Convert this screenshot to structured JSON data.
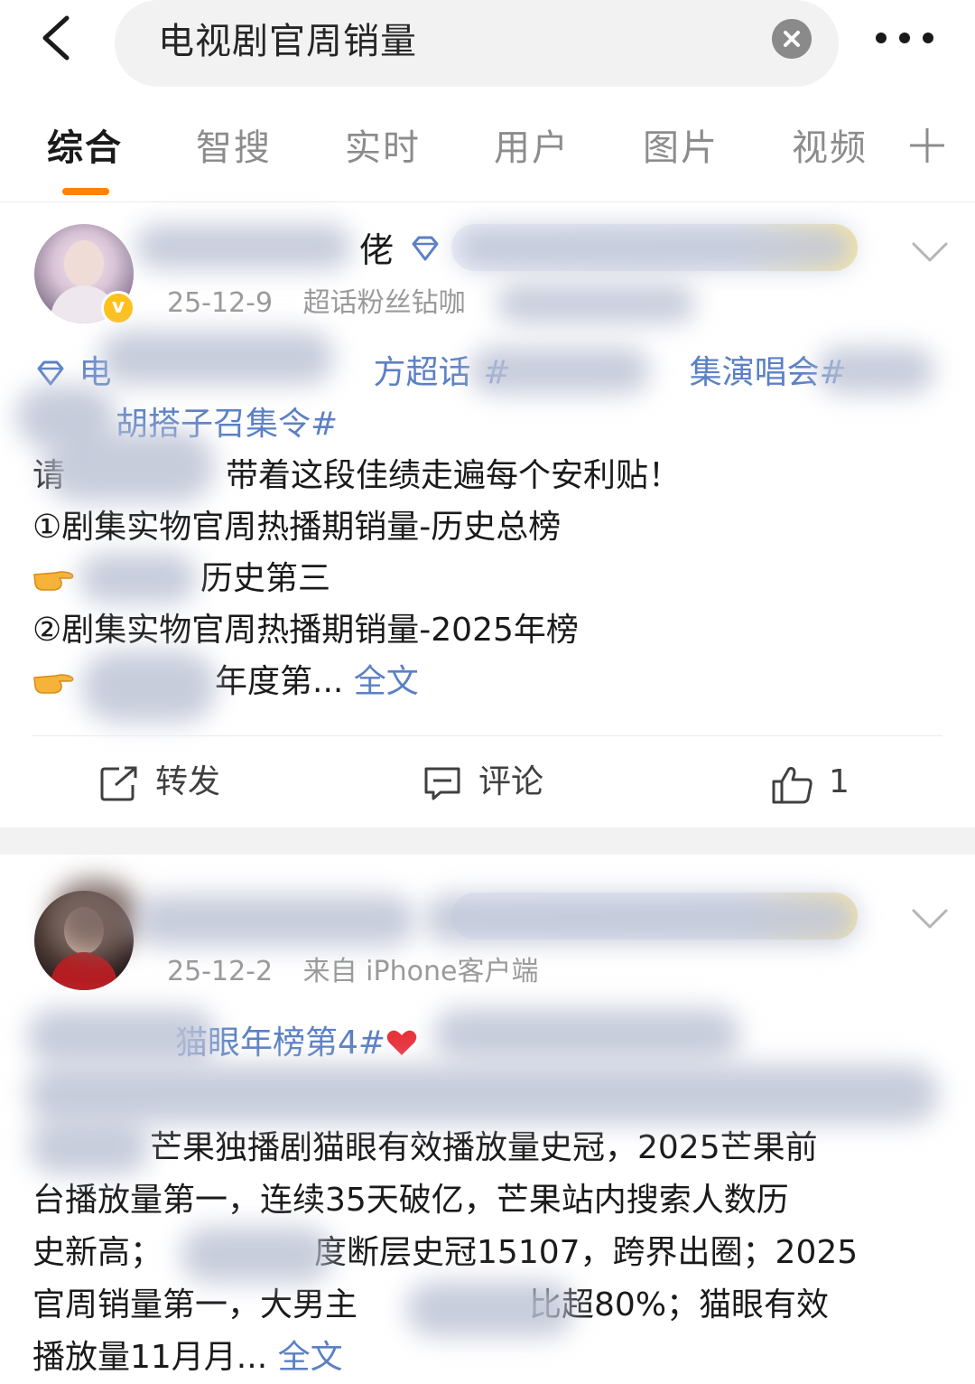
{
  "search": {
    "query": "电视剧官周销量"
  },
  "tabs": [
    {
      "label": "综合",
      "active": true
    },
    {
      "label": "智搜",
      "active": false
    },
    {
      "label": "实时",
      "active": false
    },
    {
      "label": "用户",
      "active": false
    },
    {
      "label": "图片",
      "active": false
    },
    {
      "label": "视频",
      "active": false
    }
  ],
  "colors": {
    "accent": "#ff8200",
    "link": "#5b80c5",
    "meta": "#9a9a9a",
    "vip_badge": "#ffc11a"
  },
  "posts": [
    {
      "username_visible": "佬",
      "verified_badge": "v",
      "date": "25-12-9",
      "source": "超话粉丝钻咖",
      "lines": {
        "l1a": "电",
        "l1b": "方超话",
        "l1c": "#",
        "l1d": "集演唱会#",
        "l2": "胡搭子召集令#",
        "l3a": "请",
        "l3b": "带着这段佳绩走遍每个安利贴！",
        "l4": "①剧集实物官周热播期销量-历史总榜",
        "l5": "历史第三",
        "l6": "②剧集实物官周热播期销量-2025年榜",
        "l7": "年度第...",
        "full": "全文"
      },
      "actions": {
        "repost": "转发",
        "comment": "评论",
        "like": "1"
      }
    },
    {
      "username_visible": "",
      "date": "25-12-2",
      "source": "来自 iPhone客户端",
      "lines": {
        "l1": "猫眼年榜第4#",
        "l3": "芒果独播剧猫眼有效播放量史冠，2025芒果前",
        "l4": "台播放量第一，连续35天破亿，芒果站内搜索人数历",
        "l5a": "史新高；",
        "l5b": "度断层史冠15107，跨界出圈；2025",
        "l6a": "官周销量第一，大男主",
        "l6b": "比超80%；猫眼有效",
        "l7": "播放量11月月...",
        "full": "全文"
      }
    }
  ]
}
